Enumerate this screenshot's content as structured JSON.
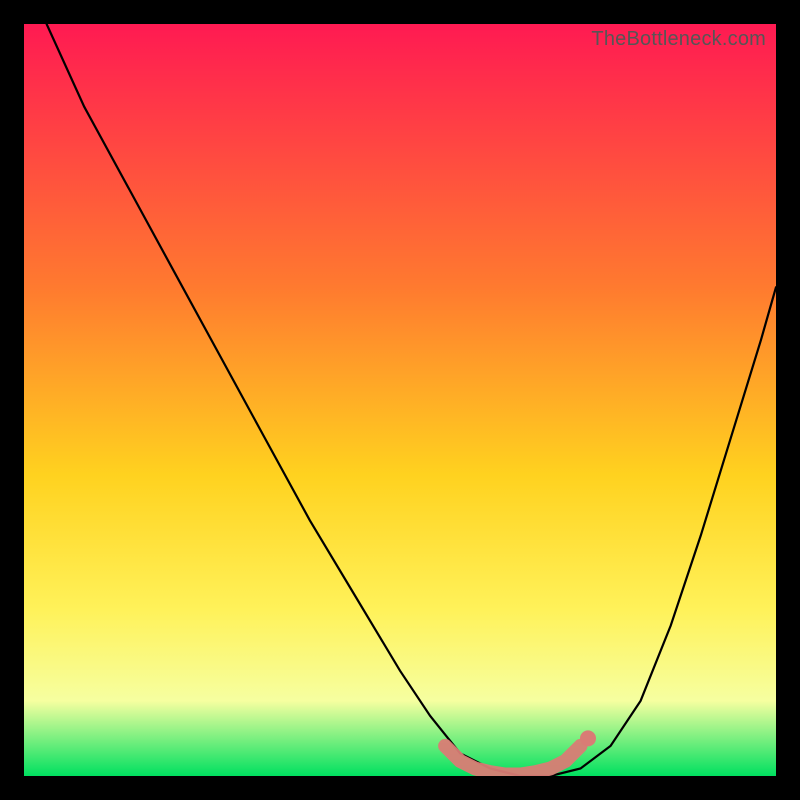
{
  "watermark": "TheBottleneck.com",
  "colors": {
    "frame_bg": "#000000",
    "grad_top": "#ff1a52",
    "grad_mid1": "#ff7a2f",
    "grad_mid2": "#ffd21f",
    "grad_mid3": "#fff25a",
    "grad_mid4": "#f6ffa0",
    "grad_bottom": "#00e060",
    "curve": "#000000",
    "marker_fill": "#d97c75",
    "marker_stroke": "#d97c75"
  },
  "chart_data": {
    "type": "line",
    "title": "",
    "xlabel": "",
    "ylabel": "",
    "xlim": [
      0,
      100
    ],
    "ylim": [
      0,
      100
    ],
    "series": [
      {
        "name": "bottleneck-curve",
        "x": [
          3,
          8,
          14,
          20,
          26,
          32,
          38,
          44,
          50,
          54,
          58,
          62,
          66,
          70,
          74,
          78,
          82,
          86,
          90,
          94,
          98,
          100
        ],
        "y": [
          100,
          89,
          78,
          67,
          56,
          45,
          34,
          24,
          14,
          8,
          3,
          1,
          0,
          0,
          1,
          4,
          10,
          20,
          32,
          45,
          58,
          65
        ]
      }
    ],
    "markers": {
      "name": "highlight-range",
      "x": [
        56,
        58,
        60,
        62,
        64,
        66,
        68,
        70,
        72,
        74
      ],
      "y": [
        4.0,
        2.0,
        1.0,
        0.5,
        0.2,
        0.2,
        0.5,
        1.0,
        2.0,
        4.0
      ]
    }
  }
}
